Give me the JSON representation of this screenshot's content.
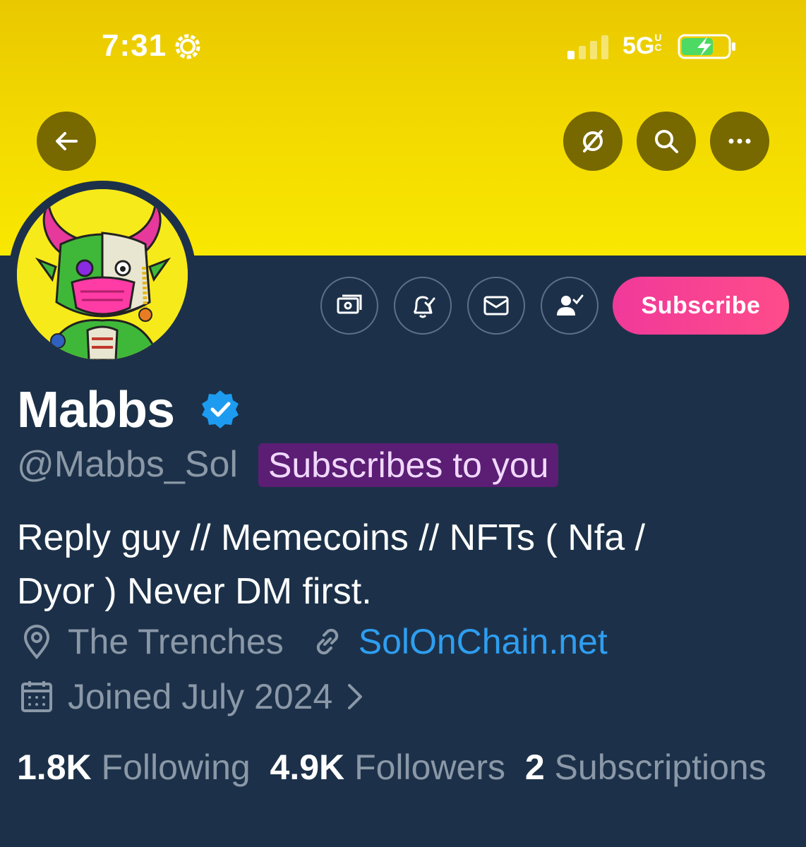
{
  "status_bar": {
    "time": "7:31",
    "network": "5G",
    "network_suffix": "UC"
  },
  "banner": {
    "color": "#f2d800",
    "buttons": [
      {
        "name": "back",
        "icon": "arrow-left-icon"
      },
      {
        "name": "grok",
        "icon": "grok-slash-icon"
      },
      {
        "name": "search",
        "icon": "search-icon"
      },
      {
        "name": "more",
        "icon": "more-dots-icon"
      }
    ]
  },
  "actions": {
    "icons": [
      "money-icon",
      "bell-check-icon",
      "mail-icon",
      "person-check-icon"
    ],
    "subscribe_label": "Subscribe",
    "subscribe_color": "#f0399a"
  },
  "profile": {
    "display_name": "Mabbs",
    "handle": "@Mabbs_Sol",
    "subscribes_badge": "Subscribes to you",
    "bio_line1": "Reply guy // Memecoins // NFTs ( Nfa /",
    "bio_line2": "Dyor ) Never DM first.",
    "location": "The Trenches",
    "website": "SolOnChain.net",
    "joined": "Joined July 2024"
  },
  "stats": {
    "following_count": "1.8K",
    "following_label": "Following",
    "followers_count": "4.9K",
    "followers_label": "Followers",
    "subscriptions_count": "2",
    "subscriptions_label": "Subscriptions"
  },
  "colors": {
    "background": "#1c3149",
    "secondary_text": "#8b98a7",
    "link": "#2f9ef0",
    "badge_bg": "#5b1e74",
    "verified": "#1d9bf0"
  }
}
